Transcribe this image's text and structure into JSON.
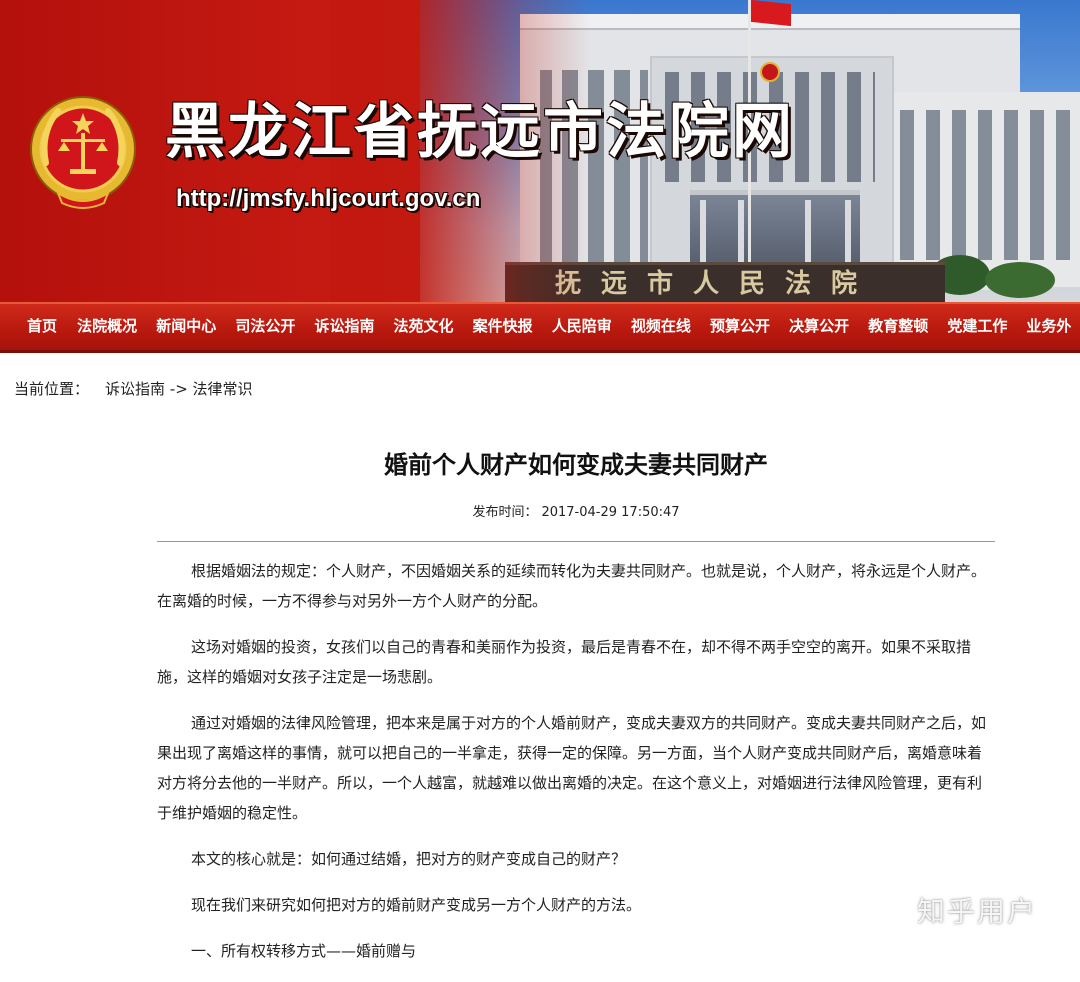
{
  "banner": {
    "site_title": "黑龙江省抚远市法院网",
    "site_url": "http://jmsfy.hljcourt.gov.cn",
    "building_sign": "抚远市人民法院"
  },
  "nav": {
    "items": [
      "首页",
      "法院概况",
      "新闻中心",
      "司法公开",
      "诉讼指南",
      "法苑文化",
      "案件快报",
      "人民陪审",
      "视频在线",
      "预算公开",
      "决算公开",
      "教育整顿",
      "党建工作",
      "业务外"
    ]
  },
  "breadcrumb": {
    "label": "当前位置：",
    "path": "诉讼指南 -> 法律常识"
  },
  "article": {
    "title": "婚前个人财产如何变成夫妻共同财产",
    "published_label": "发布时间：",
    "published_at": "2017-04-29 17:50:47",
    "paragraphs": [
      "根据婚姻法的规定：个人财产，不因婚姻关系的延续而转化为夫妻共同财产。也就是说，个人财产，将永远是个人财产。在离婚的时候，一方不得参与对另外一方个人财产的分配。",
      "这场对婚姻的投资，女孩们以自己的青春和美丽作为投资，最后是青春不在，却不得不两手空空的离开。如果不采取措施，这样的婚姻对女孩子注定是一场悲剧。",
      "通过对婚姻的法律风险管理，把本来是属于对方的个人婚前财产，变成夫妻双方的共同财产。变成夫妻共同财产之后，如果出现了离婚这样的事情，就可以把自己的一半拿走，获得一定的保障。另一方面，当个人财产变成共同财产后，离婚意味着对方将分去他的一半财产。所以，一个人越富，就越难以做出离婚的决定。在这个意义上，对婚姻进行法律风险管理，更有利于维护婚姻的稳定性。",
      "本文的核心就是：如何通过结婚，把对方的财产变成自己的财产？",
      "现在我们来研究如何把对方的婚前财产变成另一方个人财产的方法。",
      "一、所有权转移方式——婚前赠与"
    ]
  },
  "watermark": "知乎用户",
  "colors": {
    "banner_red": "#c2180f",
    "nav_red": "#b8180e",
    "text": "#222222"
  }
}
